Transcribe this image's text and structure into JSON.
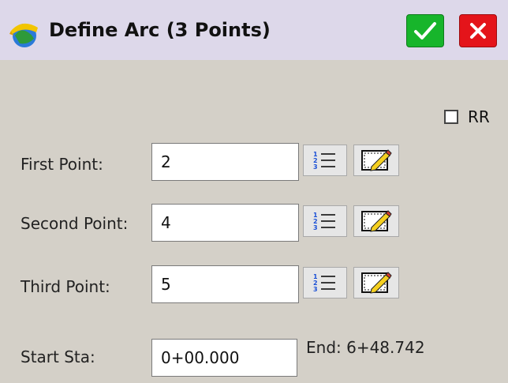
{
  "window": {
    "title": "Define Arc (3 Points)",
    "ok_icon": "checkmark-icon",
    "cancel_icon": "close-icon",
    "ok_color": "#17b52b",
    "cancel_color": "#e4141a"
  },
  "options": {
    "rr_label": "RR",
    "rr_checked": false
  },
  "fields": {
    "first_point": {
      "label": "First Point:",
      "value": "2"
    },
    "second_point": {
      "label": "Second Point:",
      "value": "4"
    },
    "third_point": {
      "label": "Third Point:",
      "value": "5"
    },
    "start_sta": {
      "label": "Start Sta:",
      "value": "0+00.000"
    }
  },
  "end_station": "End: 6+48.742",
  "icons": {
    "list": "point-list-icon",
    "map": "map-pick-icon"
  }
}
